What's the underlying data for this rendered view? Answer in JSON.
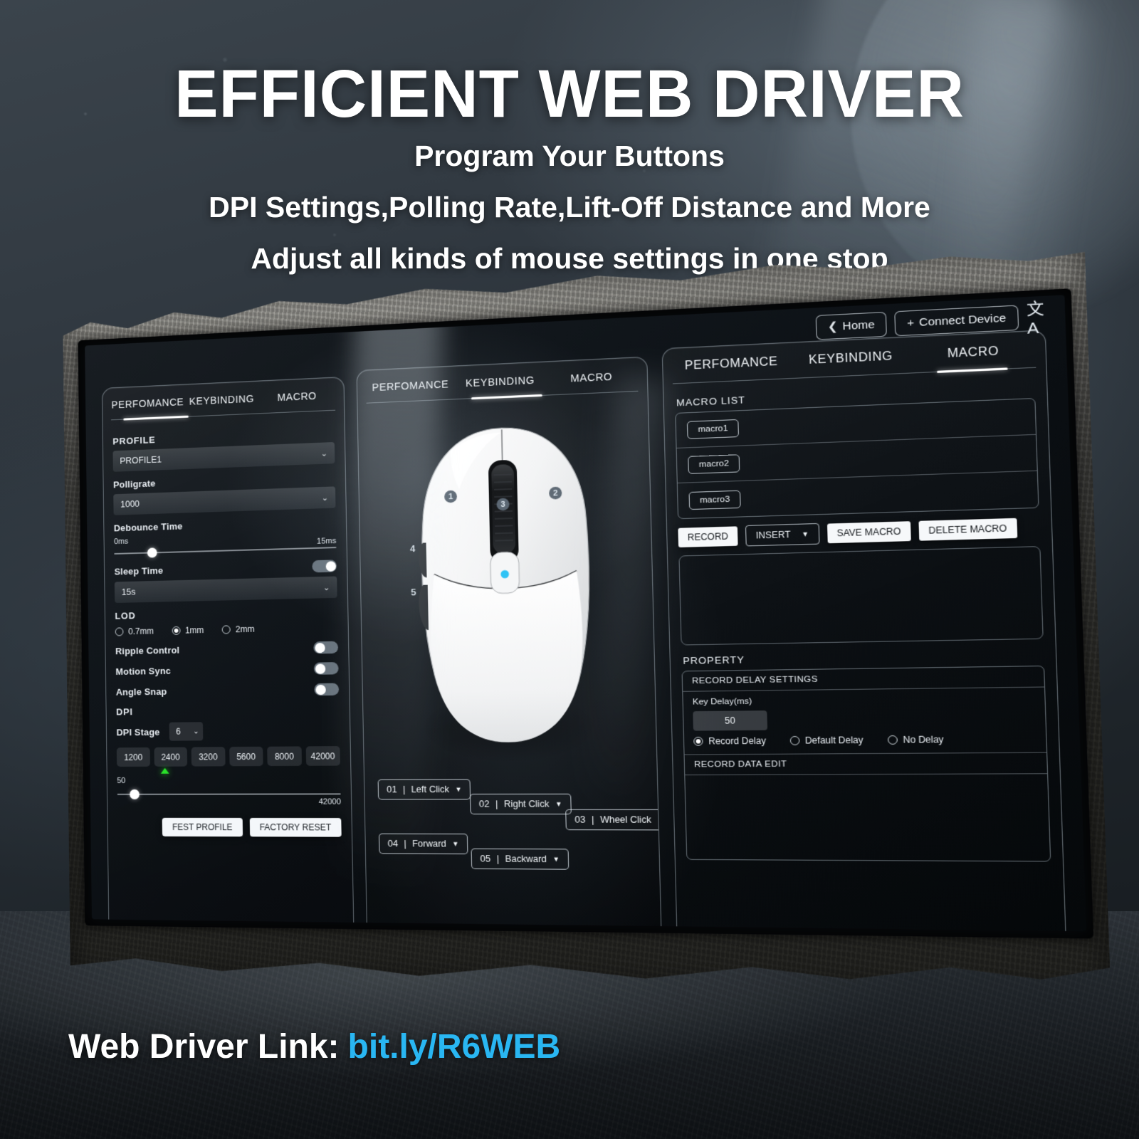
{
  "hero": {
    "title": "EFFICIENT WEB DRIVER",
    "sub1": "Program Your Buttons",
    "sub2": "DPI Settings,Polling Rate,Lift-Off Distance and More",
    "sub3": "Adjust all kinds of mouse settings in one stop"
  },
  "footer": {
    "label": "Web Driver Link:",
    "url": "bit.ly/R6WEB",
    "url_color": "#29b6f2"
  },
  "topbar": {
    "home_label": "Home",
    "home_icon": "chevron-left-icon",
    "connect_label": "Connect Device",
    "connect_icon": "plus-icon",
    "language_icon": "translate-icon",
    "language_glyph": "文A"
  },
  "tabs": [
    "PERFOMANCE",
    "KEYBINDING",
    "MACRO"
  ],
  "panel_left": {
    "active_tab": "PERFOMANCE",
    "profile_label": "PROFILE",
    "profile_value": "PROFILE1",
    "polligrate_label": "Polligrate",
    "polligrate_value": "1000",
    "debounce_label": "Debounce Time",
    "debounce_min": "0ms",
    "debounce_max": "15ms",
    "sleep_label": "Sleep Time",
    "sleep_value": "15s",
    "sleep_toggle": "on",
    "lod_label": "LOD",
    "lod_options": [
      {
        "label": "0.7mm",
        "selected": false
      },
      {
        "label": "1mm",
        "selected": true
      },
      {
        "label": "2mm",
        "selected": false
      }
    ],
    "ripple_label": "Ripple Control",
    "ripple_toggle": "off",
    "motion_label": "Motion Sync",
    "motion_toggle": "off",
    "angle_label": "Angle Snap",
    "angle_toggle": "off",
    "dpi_label": "DPI",
    "dpi_stage_label": "DPI Stage",
    "dpi_stage_value": "6",
    "dpi_chips": [
      "1200",
      "2400",
      "3200",
      "5600",
      "8000",
      "42000"
    ],
    "dpi_active_index": 1,
    "dpi_slider_min": "50",
    "dpi_slider_max": "42000",
    "test_profile_label": "FEST PROFILE",
    "factory_reset_label": "FACTORY RESET"
  },
  "panel_mid": {
    "active_tab": "KEYBINDING",
    "callouts": [
      "1",
      "2",
      "3",
      "4",
      "5"
    ],
    "buttons": [
      {
        "id": "01",
        "label": "Left Click"
      },
      {
        "id": "02",
        "label": "Right Click"
      },
      {
        "id": "03",
        "label": "Wheel Click"
      },
      {
        "id": "04",
        "label": "Forward"
      },
      {
        "id": "05",
        "label": "Backward"
      }
    ]
  },
  "panel_right": {
    "active_tab": "MACRO",
    "macro_list_label": "MACRO  LIST",
    "macros": [
      "macro1",
      "macro2",
      "macro3"
    ],
    "record_label": "RECORD",
    "insert_label": "INSERT",
    "save_macro_label": "SAVE MACRO",
    "delete_macro_label": "DELETE MACRO",
    "property_label": "PROPERTY",
    "record_delay_settings_label": "RECORD DELAY SETTINGS",
    "key_delay_label": "Key Delay(ms)",
    "key_delay_value": "50",
    "delay_options": [
      {
        "label": "Record Delay",
        "selected": true
      },
      {
        "label": "Default Delay",
        "selected": false
      },
      {
        "label": "No Delay",
        "selected": false
      }
    ],
    "record_data_edit_label": "RECORD DATA EDIT"
  }
}
